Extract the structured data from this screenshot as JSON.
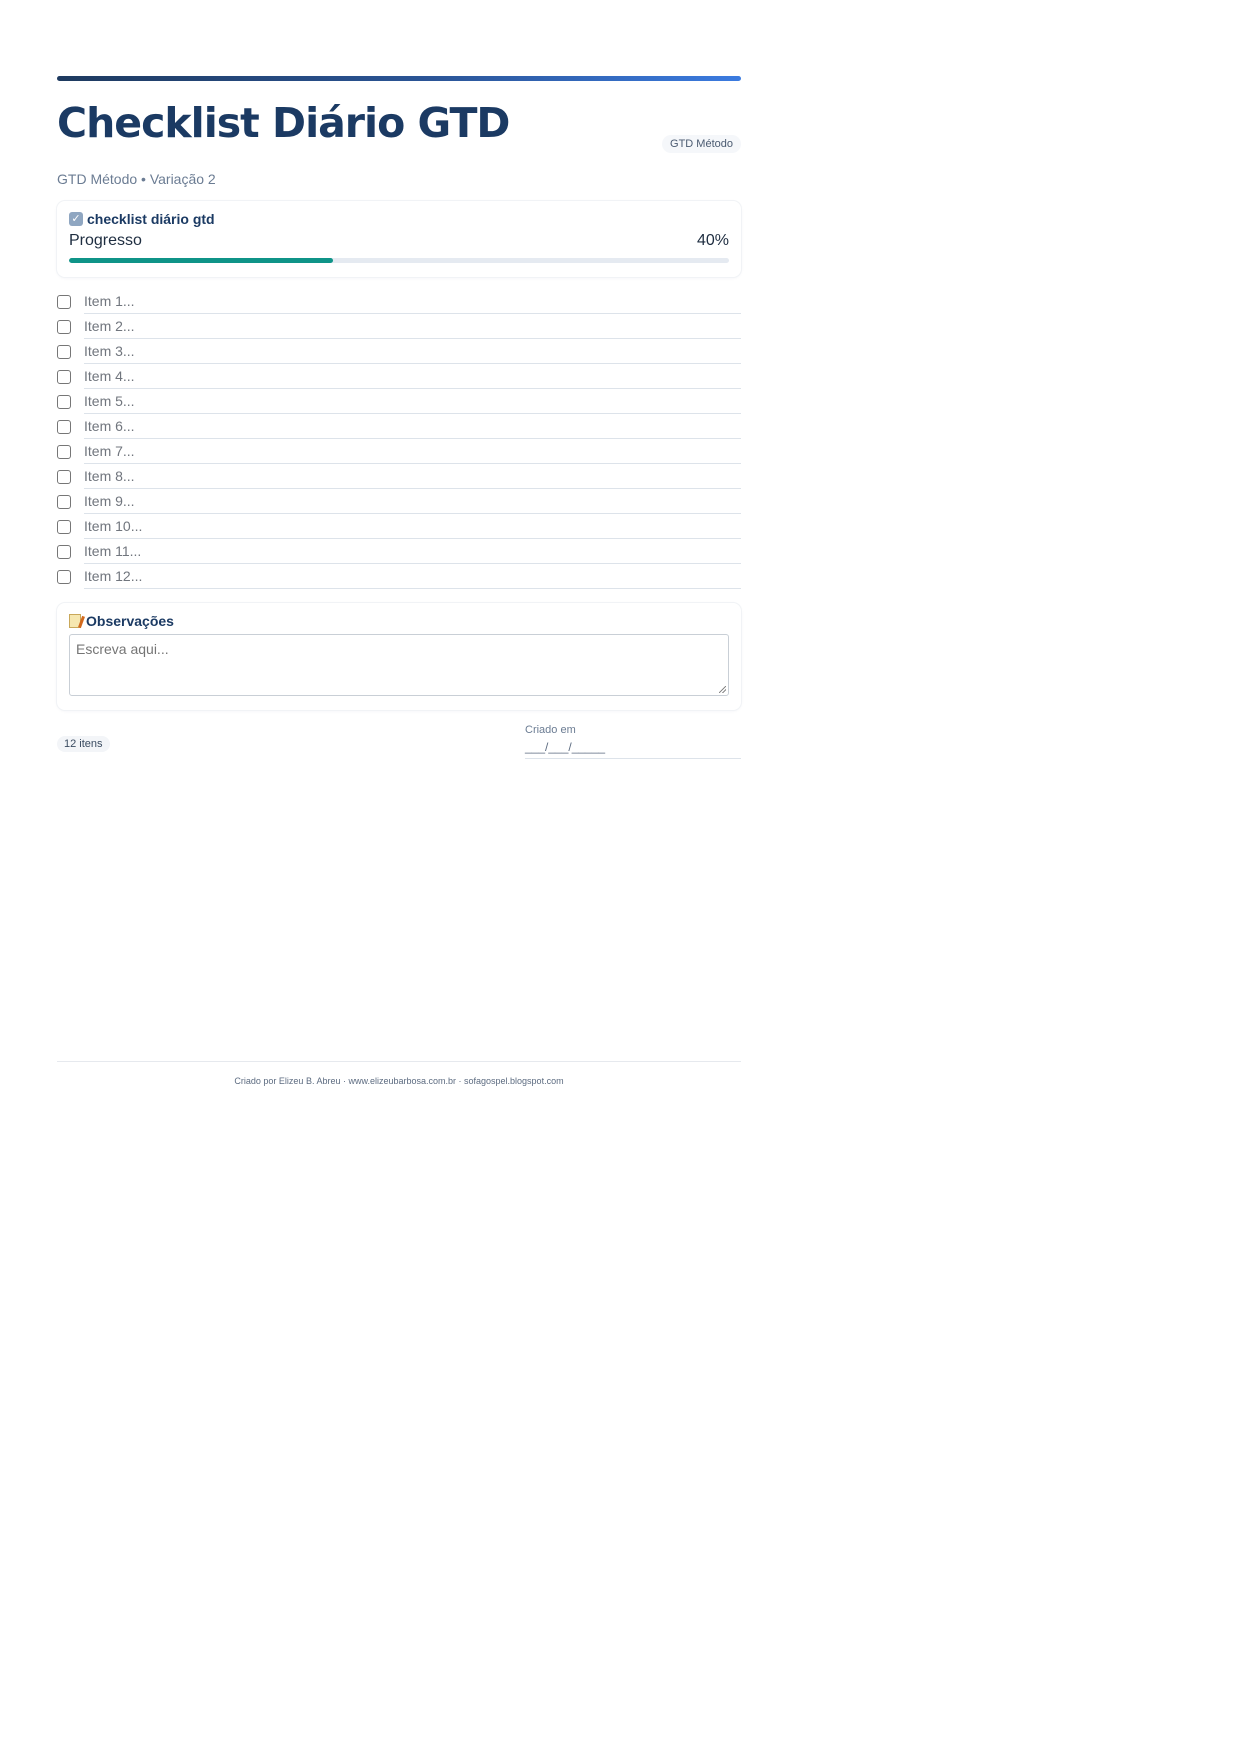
{
  "header": {
    "title": "Checklist Diário GTD",
    "method_badge": "GTD Método",
    "subtitle": "GTD Método • Variação 2"
  },
  "checklist_card": {
    "title": "checklist diário gtd",
    "title_icon": "checkbox-icon",
    "progress_label": "Progresso",
    "progress_text": "40%",
    "progress_value": 0.4,
    "progress_color": "#0f9488"
  },
  "items": [
    {
      "label": "Item 1..."
    },
    {
      "label": "Item 2..."
    },
    {
      "label": "Item 3..."
    },
    {
      "label": "Item 4..."
    },
    {
      "label": "Item 5..."
    },
    {
      "label": "Item 6..."
    },
    {
      "label": "Item 7..."
    },
    {
      "label": "Item 8..."
    },
    {
      "label": "Item 9..."
    },
    {
      "label": "Item 10..."
    },
    {
      "label": "Item 11..."
    },
    {
      "label": "Item 12..."
    }
  ],
  "notes": {
    "title": "Observações",
    "title_icon": "memo-icon",
    "placeholder": "Escreva aqui..."
  },
  "meta": {
    "item_count": "12 itens",
    "created_label": "Criado em",
    "created_value": "___/___/_____"
  },
  "footer": {
    "credit": "Criado por Elizeu B. Abreu · www.elizeubarbosa.com.br · sofagospel.blogspot.com"
  },
  "colors": {
    "title": "#1b3a63",
    "accent_gradient_start": "#1e3a5f",
    "accent_gradient_end": "#3b7be0"
  }
}
